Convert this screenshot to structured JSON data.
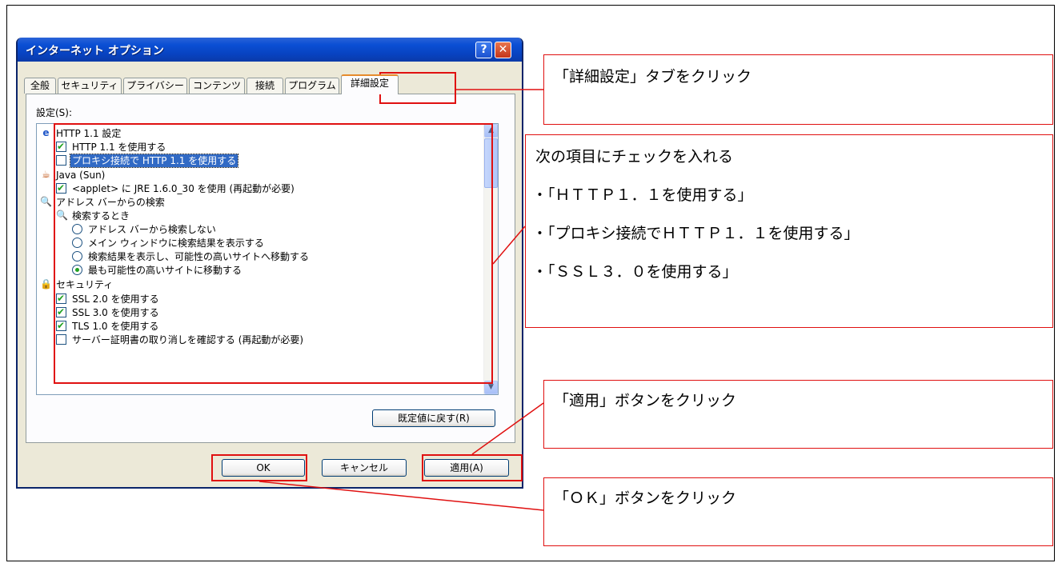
{
  "dialog": {
    "title": "インターネット オプション",
    "help_label": "?",
    "close_label": "✕",
    "tabs": [
      "全般",
      "セキュリティ",
      "プライバシー",
      "コンテンツ",
      "接続",
      "プログラム",
      "詳細設定"
    ],
    "active_tab": "詳細設定",
    "settings_label": "設定(S):",
    "items": {
      "http_header": "HTTP 1.1 設定",
      "http_use": "HTTP 1.1 を使用する",
      "http_proxy": "プロキシ接続で HTTP 1.1 を使用する",
      "java_header": "Java (Sun)",
      "java_applet": "<applet> に JRE 1.6.0_30 を使用 (再起動が必要)",
      "search_header": "アドレス バーからの検索",
      "search_when": "検索するとき",
      "search_opt1": "アドレス バーから検索しない",
      "search_opt2": "メイン ウィンドウに検索結果を表示する",
      "search_opt3": "検索結果を表示し、可能性の高いサイトへ移動する",
      "search_opt4": "最も可能性の高いサイトに移動する",
      "security_header": "セキュリティ",
      "ssl2": "SSL 2.0 を使用する",
      "ssl3": "SSL 3.0 を使用する",
      "tls1": "TLS 1.0 を使用する",
      "cert_revoke": "サーバー証明書の取り消しを確認する (再起動が必要)"
    },
    "restore_defaults_label": "既定値に戻す(R)",
    "ok_label": "OK",
    "cancel_label": "キャンセル",
    "apply_label": "適用(A)"
  },
  "annotations": {
    "tab_note": "「詳細設定」タブをクリック",
    "check_note_title": "次の項目にチェックを入れる",
    "check_note_items": [
      "・「ＨＴＴＰ１．１を使用する」",
      "・「プロキシ接続でＨＴＴＰ１．１を使用する」",
      "・「ＳＳＬ３．０を使用する」"
    ],
    "apply_note": "「適用」ボタンをクリック",
    "ok_note": "「ＯＫ」ボタンをクリック"
  },
  "colors": {
    "annotation_red": "#e01010",
    "xp_title_blue": "#0a4fd4",
    "dialog_bg": "#ece9d8"
  }
}
